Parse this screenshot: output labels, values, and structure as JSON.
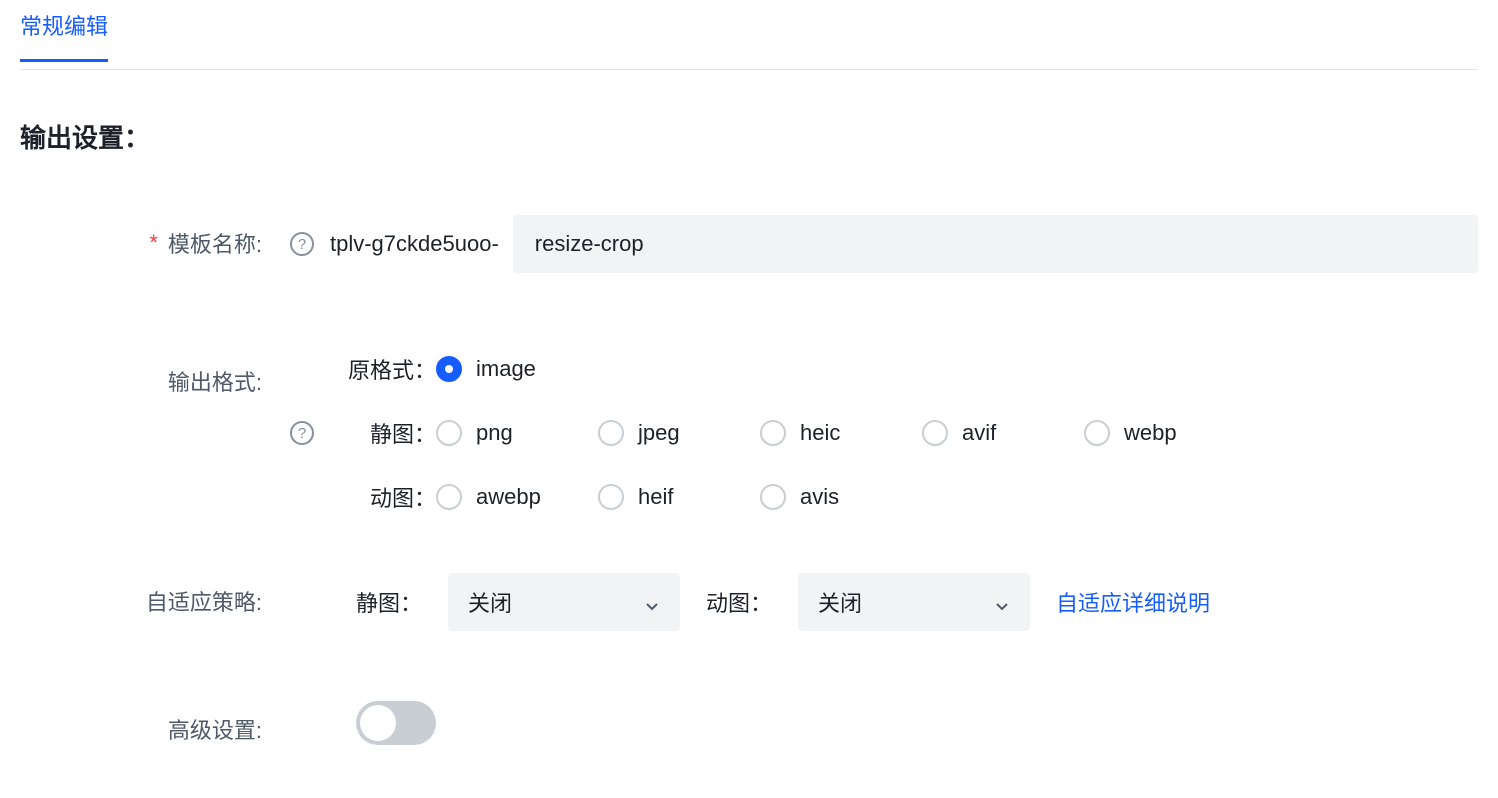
{
  "tabs": {
    "active": "常规编辑"
  },
  "section_title": "输出设置：",
  "template_name": {
    "label": "模板名称:",
    "prefix": "tplv-g7ckde5uoo-",
    "value": "resize-crop"
  },
  "output_format": {
    "label": "输出格式:",
    "original_label": "原格式：",
    "static_label": "静图：",
    "animated_label": "动图：",
    "options": {
      "original": [
        {
          "value": "image",
          "checked": true
        }
      ],
      "static": [
        {
          "value": "png",
          "checked": false
        },
        {
          "value": "jpeg",
          "checked": false
        },
        {
          "value": "heic",
          "checked": false
        },
        {
          "value": "avif",
          "checked": false
        },
        {
          "value": "webp",
          "checked": false
        }
      ],
      "animated": [
        {
          "value": "awebp",
          "checked": false
        },
        {
          "value": "heif",
          "checked": false
        },
        {
          "value": "avis",
          "checked": false
        }
      ]
    }
  },
  "adaptive": {
    "label": "自适应策略:",
    "static_label": "静图：",
    "animated_label": "动图：",
    "static_value": "关闭",
    "animated_value": "关闭",
    "detail_link": "自适应详细说明"
  },
  "advanced": {
    "label": "高级设置:",
    "enabled": false
  }
}
